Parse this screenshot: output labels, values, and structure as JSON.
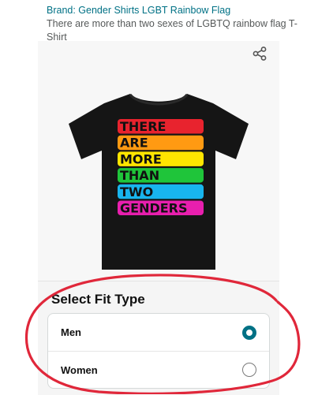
{
  "header": {
    "brand_link": "Brand: Gender Shirts LGBT Rainbow Flag",
    "title": "There are more than two sexes of LGBTQ rainbow flag T-Shirt"
  },
  "product_image": {
    "shirt_lines": [
      "THERE",
      "ARE",
      "MORE",
      "THAN",
      "TWO",
      "GENDERS"
    ],
    "stripe_colors": [
      "#e8232e",
      "#ff9a12",
      "#ffe500",
      "#1fc53a",
      "#18b5ee",
      "#e81fae"
    ],
    "shirt_color": "#151515"
  },
  "share": {
    "icon": "share-icon"
  },
  "fit": {
    "title": "Select Fit Type",
    "options": [
      {
        "label": "Men",
        "selected": true
      },
      {
        "label": "Women",
        "selected": false
      }
    ],
    "accent_color": "#007185"
  },
  "annotation": {
    "color": "#e0273a"
  }
}
